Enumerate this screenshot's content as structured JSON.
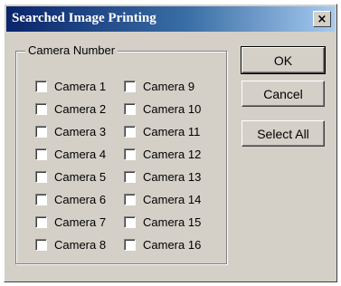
{
  "window": {
    "title": "Searched Image Printing",
    "close_glyph": "×"
  },
  "camera_group": {
    "label": "Camera Number",
    "cameras": [
      {
        "label": "Camera 1",
        "checked": false
      },
      {
        "label": "Camera 2",
        "checked": false
      },
      {
        "label": "Camera 3",
        "checked": false
      },
      {
        "label": "Camera 4",
        "checked": false
      },
      {
        "label": "Camera 5",
        "checked": false
      },
      {
        "label": "Camera 6",
        "checked": false
      },
      {
        "label": "Camera 7",
        "checked": false
      },
      {
        "label": "Camera 8",
        "checked": false
      },
      {
        "label": "Camera 9",
        "checked": false
      },
      {
        "label": "Camera 10",
        "checked": false
      },
      {
        "label": "Camera 11",
        "checked": false
      },
      {
        "label": "Camera 12",
        "checked": false
      },
      {
        "label": "Camera 13",
        "checked": false
      },
      {
        "label": "Camera 14",
        "checked": false
      },
      {
        "label": "Camera 15",
        "checked": false
      },
      {
        "label": "Camera 16",
        "checked": false
      }
    ]
  },
  "buttons": {
    "ok": "OK",
    "cancel": "Cancel",
    "select_all": "Select All"
  }
}
